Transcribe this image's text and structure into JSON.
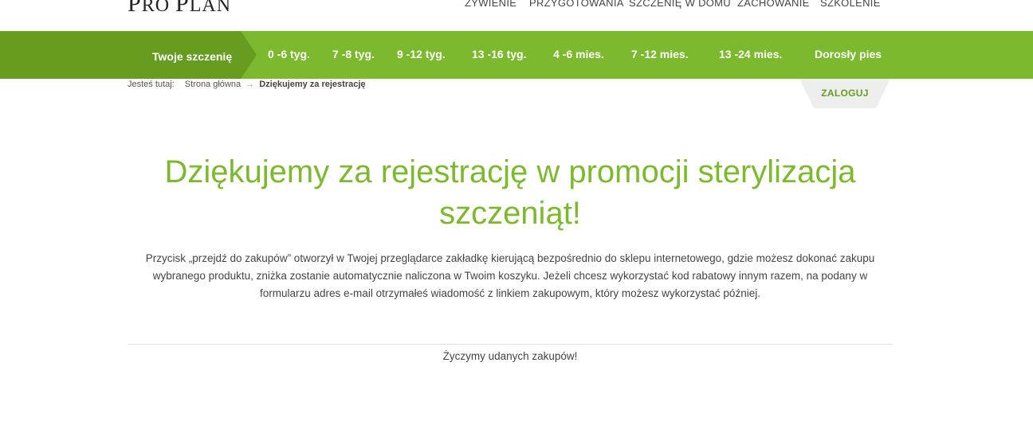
{
  "logo": {
    "text_big": "P",
    "text_rest": "RO ",
    "text_big2": "P",
    "text_rest2": "LAN"
  },
  "top_nav": [
    "ŻYWIENIE",
    "PRZYGOTOWANIA",
    "SZCZENIĘ W DOMU",
    "ZACHOWANIE",
    "SZKOLENIE"
  ],
  "age_bar": {
    "active": "Twoje szczenię",
    "items": [
      "0 -6 tyg.",
      "7 -8 tyg.",
      "9 -12 tyg.",
      "13 -16 tyg.",
      "4 -6 mies.",
      "7 -12 mies.",
      "13 -24 mies.",
      "Dorosły pies"
    ]
  },
  "breadcrumb": {
    "label": "Jesteś tutaj:",
    "home": "Strona główna",
    "arrow": "→",
    "current": "Dziękujemy za rejestrację"
  },
  "login_label": "ZALOGUJ",
  "heading": "Dziękujemy za rejestrację w promocji sterylizacja szczeniąt!",
  "body": "Przycisk „przejdź do zakupów” otworzył w Twojej przeglądarce zakładkę kierującą bezpośrednio do sklepu internetowego, gdzie możesz dokonać zakupu wybranego produktu, zniżka zostanie automatycznie naliczona w Twoim koszyku. Jeżeli chcesz wykorzystać kod rabatowy innym razem, na podany w formularzu adres e-mail otrzymałeś wiadomość z linkiem zakupowym, który możesz wykorzystać później.",
  "closing": "Życzymy udanych zakupów!",
  "colors": {
    "accent": "#7db92f",
    "accent_dark": "#669c1f"
  }
}
